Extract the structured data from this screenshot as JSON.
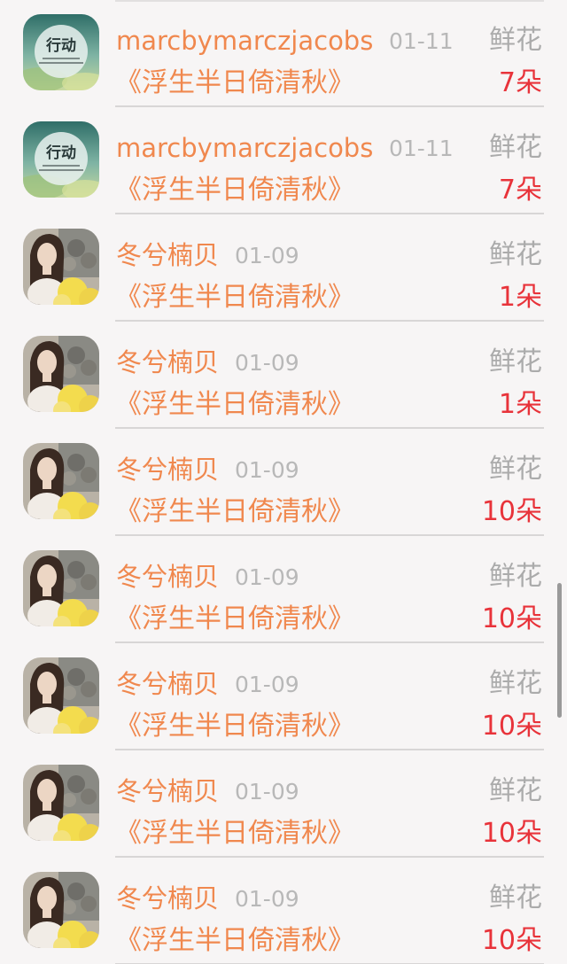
{
  "entries": [
    {
      "name": "marcbymarczjacobs",
      "date": "01-11",
      "kind": "鲜花",
      "title": "《浮生半日倚清秋》",
      "count": "7朵",
      "avatar_type": "logo",
      "avatar_text": "行动"
    },
    {
      "name": "marcbymarczjacobs",
      "date": "01-11",
      "kind": "鲜花",
      "title": "《浮生半日倚清秋》",
      "count": "7朵",
      "avatar_type": "logo",
      "avatar_text": "行动"
    },
    {
      "name": "冬兮楠贝",
      "date": "01-09",
      "kind": "鲜花",
      "title": "《浮生半日倚清秋》",
      "count": "1朵",
      "avatar_type": "photo"
    },
    {
      "name": "冬兮楠贝",
      "date": "01-09",
      "kind": "鲜花",
      "title": "《浮生半日倚清秋》",
      "count": "1朵",
      "avatar_type": "photo"
    },
    {
      "name": "冬兮楠贝",
      "date": "01-09",
      "kind": "鲜花",
      "title": "《浮生半日倚清秋》",
      "count": "10朵",
      "avatar_type": "photo"
    },
    {
      "name": "冬兮楠贝",
      "date": "01-09",
      "kind": "鲜花",
      "title": "《浮生半日倚清秋》",
      "count": "10朵",
      "avatar_type": "photo"
    },
    {
      "name": "冬兮楠贝",
      "date": "01-09",
      "kind": "鲜花",
      "title": "《浮生半日倚清秋》",
      "count": "10朵",
      "avatar_type": "photo"
    },
    {
      "name": "冬兮楠贝",
      "date": "01-09",
      "kind": "鲜花",
      "title": "《浮生半日倚清秋》",
      "count": "10朵",
      "avatar_type": "photo"
    },
    {
      "name": "冬兮楠贝",
      "date": "01-09",
      "kind": "鲜花",
      "title": "《浮生半日倚清秋》",
      "count": "10朵",
      "avatar_type": "photo"
    }
  ],
  "colors": {
    "name": "#f0884e",
    "title": "#f0884e",
    "count": "#e8333a",
    "meta": "#b8b8b8",
    "background": "#f7f5f5"
  }
}
